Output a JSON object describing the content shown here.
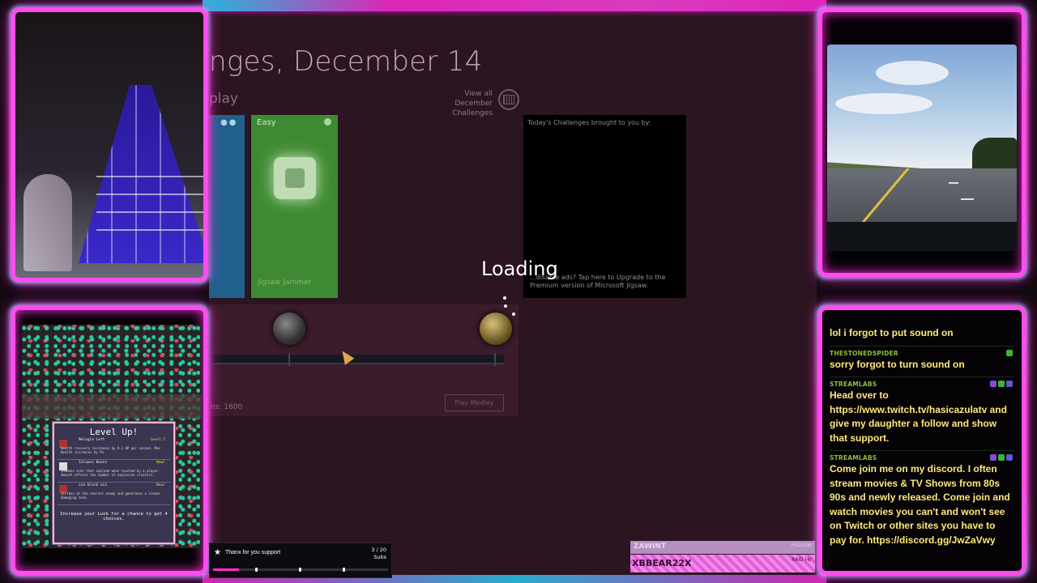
{
  "game": {
    "title": "nges, December 14",
    "subtitle": "play",
    "view_all": "View all",
    "view_all_sub": "December Challenges",
    "tile_difficulty": "Easy",
    "tile_name": "Jigsaw Jammer",
    "ad_top": "Today's Challenges brought to you by:",
    "ad_bottom": "...disable ads? Tap here to Upgrade to the Premium version of Microsoft Jigsaw.",
    "points": "ns: 1600",
    "play_button": "Play Medley",
    "loading": "Loading"
  },
  "levelup": {
    "title": "Level Up!",
    "items": [
      {
        "name": "Melaglo Left",
        "level": "level:7",
        "desc": "Health recovery increases by 0.1 HP per second. Max Health increases by 5%."
      },
      {
        "name": "Inlaeos Boons",
        "level": "New!",
        "desc": "Summons orbs that explode when touched by a player. Amount affects the number of explosion clusters."
      },
      {
        "name": "ice block wiz",
        "level": "New!",
        "desc": "Strikes at the nearest enemy and generates a linear damaging zone."
      }
    ],
    "footer": "Increase your Luck for a chance to get 4 choices."
  },
  "chat": {
    "messages": [
      {
        "user": "THESTONEDSPIDER",
        "text": "lol i forgot to put sound on"
      },
      {
        "user": "THESTONEDSPIDER",
        "text": "sorry forgot to turn sound on"
      },
      {
        "user": "STREAMLABS",
        "text": "Head over to https://www.twitch.tv/hasicazulatv and give my daughter a follow and show that support."
      },
      {
        "user": "STREAMLABS",
        "text": "Come join me on my discord. I often stream movies & TV Shows from 80s 90s and newly released. Come join and watch movies you can't and won't see on Twitch or other sites you have to pay for. https://discord.gg/JwZaVwy"
      }
    ]
  },
  "sub_goal": {
    "label": "Thanx for you support",
    "count": "3 / 20",
    "unit": "Subs",
    "progress": 0.15
  },
  "ticker": {
    "follow_name": "ZAWINT",
    "follow_label": "FOLLOW",
    "raid_name": "XBBEAR22X",
    "raid_label": "RAID (4)"
  },
  "colors": {
    "neon": "#ff2bd6",
    "accent_cyan": "#2bd6ff",
    "chat_text": "#ffe97a",
    "chat_user": "#8abf38"
  }
}
